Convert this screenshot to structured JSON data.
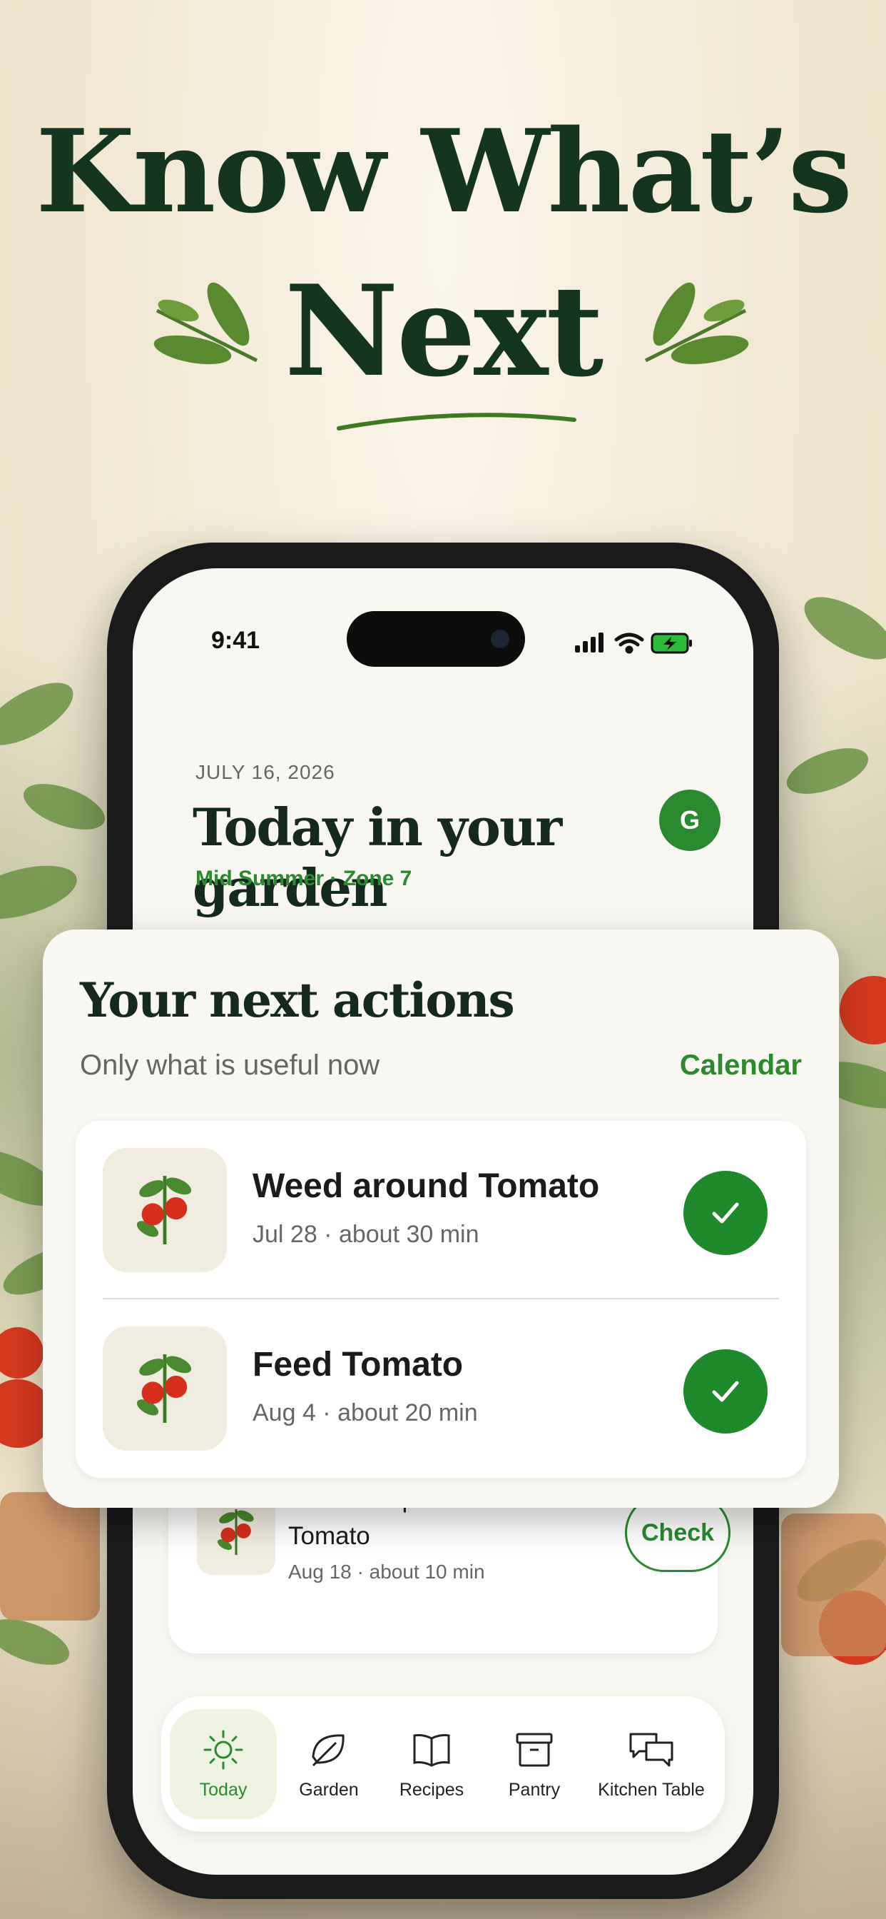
{
  "headline": {
    "line1": "Know What’s",
    "line2": "Next"
  },
  "status_bar": {
    "time": "9:41"
  },
  "header": {
    "date": "JULY 16, 2026",
    "title": "Today in your garden",
    "avatar_initial": "G",
    "season": "Mid Summer · Zone 7"
  },
  "actions_card": {
    "title": "Your next actions",
    "subtitle": "Only what is useful now",
    "calendar_label": "Calendar",
    "tasks": [
      {
        "title": "Weed around Tomato",
        "meta": "Jul 28 · about 30 min",
        "icon": "tomato-plant-icon",
        "done_icon": "checkmark-icon"
      },
      {
        "title": "Feed Tomato",
        "meta": "Aug 4 · about 20 min",
        "icon": "tomato-plant-icon",
        "done_icon": "checkmark-icon"
      }
    ]
  },
  "upcoming_task": {
    "title": "Check for pests on Tomato",
    "meta": "Aug 18 · about 10 min",
    "button_label": "Check",
    "icon": "tomato-plant-icon"
  },
  "tab_bar": {
    "tabs": [
      {
        "label": "Today",
        "icon": "sun-icon",
        "active": true
      },
      {
        "label": "Garden",
        "icon": "leaf-icon"
      },
      {
        "label": "Recipes",
        "icon": "book-icon"
      },
      {
        "label": "Pantry",
        "icon": "storage-box-icon"
      },
      {
        "label": "Kitchen Table",
        "icon": "chat-bubbles-icon"
      }
    ]
  },
  "colors": {
    "accent": "#2a8a2f",
    "headline": "#14361f",
    "surface": "#f9f7f1"
  }
}
